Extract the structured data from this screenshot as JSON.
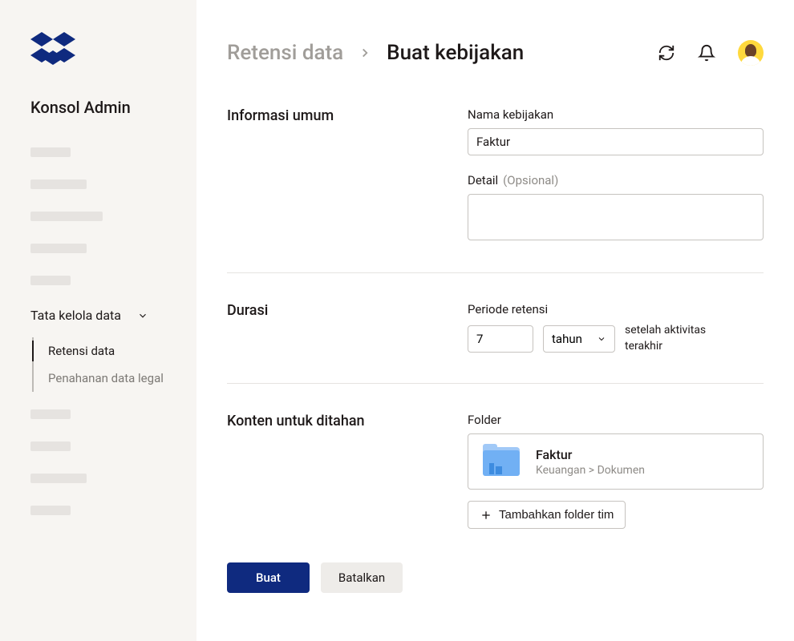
{
  "sidebar": {
    "title": "Konsol Admin",
    "section": {
      "label": "Tata kelola data",
      "items": [
        {
          "label": "Retensi data",
          "active": true
        },
        {
          "label": "Penahanan data legal",
          "active": false
        }
      ]
    }
  },
  "breadcrumb": {
    "parent": "Retensi data",
    "current": "Buat kebijakan"
  },
  "form": {
    "general": {
      "title": "Informasi umum",
      "policy_name_label": "Nama kebijakan",
      "policy_name_value": "Faktur",
      "detail_label": "Detail",
      "detail_optional": "(Opsional)",
      "detail_value": ""
    },
    "duration": {
      "title": "Durasi",
      "period_label": "Periode retensi",
      "period_value": "7",
      "unit_value": "tahun",
      "after_text": "setelah aktivitas terakhir"
    },
    "content": {
      "title": "Konten untuk ditahan",
      "folder_label": "Folder",
      "folder": {
        "name": "Faktur",
        "path": "Keuangan > Dokumen"
      },
      "add_button": "Tambahkan folder tim"
    }
  },
  "footer": {
    "create": "Buat",
    "cancel": "Batalkan"
  }
}
